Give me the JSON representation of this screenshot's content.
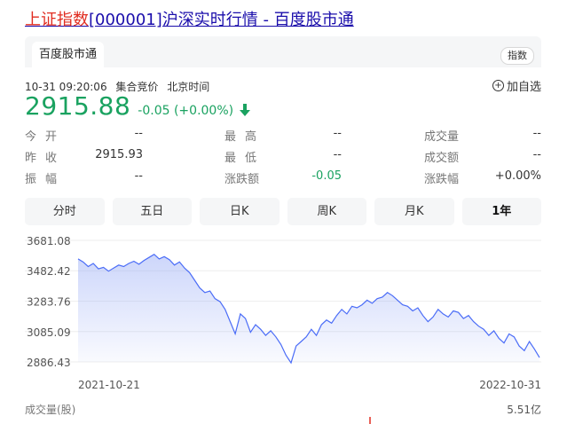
{
  "page": {
    "title_highlight": "上证指数",
    "title_rest": "[000001]沪深实时行情 - 百度股市通"
  },
  "tab": {
    "source_label": "百度股市通",
    "type_badge": "指数"
  },
  "quote": {
    "datetime": "10-31 09:20:06",
    "session": "集合竞价",
    "timezone": "北京时间",
    "add_watchlist": "加自选",
    "price": "2915.88",
    "change": "-0.05 (+0.00%)",
    "trend_icon": "down-arrow-icon",
    "up_color": "#e02c20",
    "down_color": "#1aa260"
  },
  "stats": [
    [
      {
        "label": "今开",
        "value": "--"
      },
      {
        "label": "最高",
        "value": "--"
      },
      {
        "label": "成交量",
        "value": "--"
      }
    ],
    [
      {
        "label": "昨收",
        "value": "2915.93"
      },
      {
        "label": "最低",
        "value": "--"
      },
      {
        "label": "成交额",
        "value": "--"
      }
    ],
    [
      {
        "label": "振幅",
        "value": "--"
      },
      {
        "label": "涨跌额",
        "value": "-0.05"
      },
      {
        "label": "涨跌幅",
        "value": "+0.00%"
      }
    ]
  ],
  "periods": [
    {
      "label": "分时",
      "active": false
    },
    {
      "label": "五日",
      "active": false
    },
    {
      "label": "日K",
      "active": false
    },
    {
      "label": "周K",
      "active": false
    },
    {
      "label": "月K",
      "active": false
    },
    {
      "label": "1年",
      "active": true
    }
  ],
  "chart_data": {
    "type": "area",
    "y_ticks": [
      "3681.08",
      "3482.42",
      "3283.76",
      "3085.09",
      "2886.43"
    ],
    "ylim": [
      2886.43,
      3681.08
    ],
    "x_start_label": "2021-10-21",
    "x_end_label": "2022-10-31",
    "volume_label": "成交量(股)",
    "volume_value": "5.51亿",
    "line_color": "#4a6cf7",
    "values": [
      3560,
      3540,
      3510,
      3530,
      3495,
      3505,
      3480,
      3500,
      3520,
      3510,
      3530,
      3545,
      3525,
      3550,
      3570,
      3590,
      3560,
      3575,
      3555,
      3520,
      3540,
      3500,
      3470,
      3420,
      3370,
      3340,
      3350,
      3300,
      3280,
      3230,
      3150,
      3070,
      3200,
      3170,
      3080,
      3130,
      3100,
      3060,
      3090,
      3050,
      3000,
      2930,
      2880,
      2990,
      3020,
      3050,
      3100,
      3060,
      3130,
      3160,
      3140,
      3190,
      3230,
      3200,
      3250,
      3240,
      3260,
      3290,
      3270,
      3300,
      3310,
      3340,
      3320,
      3290,
      3260,
      3250,
      3220,
      3240,
      3190,
      3150,
      3180,
      3230,
      3200,
      3180,
      3220,
      3210,
      3170,
      3190,
      3150,
      3120,
      3100,
      3060,
      3090,
      3040,
      3010,
      3070,
      3050,
      2990,
      2960,
      3020,
      2970,
      2915
    ]
  }
}
